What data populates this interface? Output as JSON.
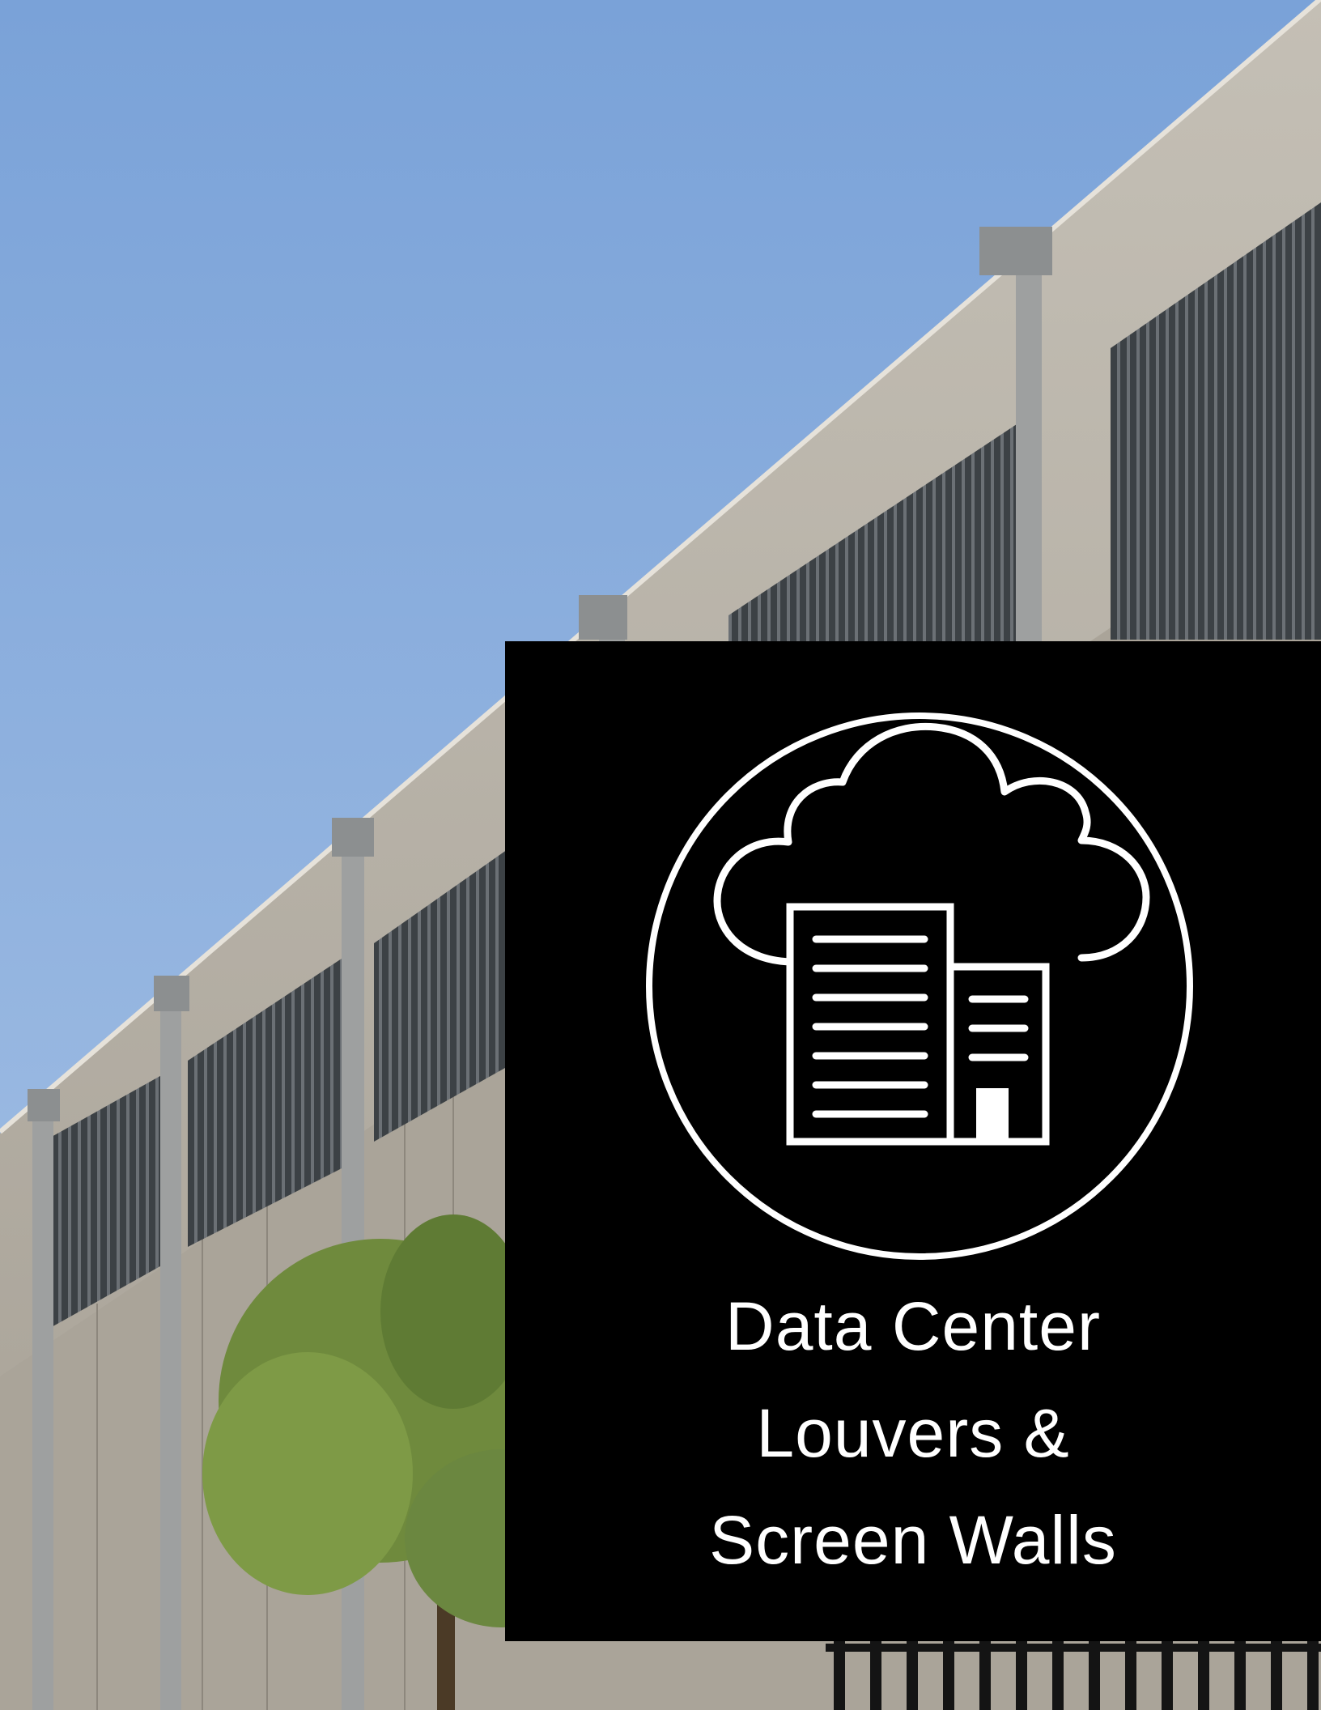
{
  "caption": {
    "line1": "Data Center",
    "line2": "Louvers &",
    "line3": "Screen Walls"
  },
  "colors": {
    "sky_top": "#7ba2d6",
    "sky_bottom": "#a9c4e4",
    "wall": "#b7b2a8",
    "louver": "#3f4448",
    "panel": "#000000",
    "icon": "#ffffff",
    "tree": "#6e8a3c"
  },
  "icons": [
    "cloud-building-icon"
  ]
}
